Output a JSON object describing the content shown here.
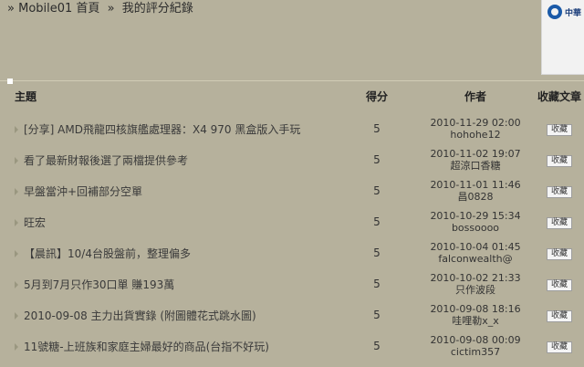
{
  "breadcrumb": {
    "lead": "»",
    "home": "Mobile01 首頁",
    "sep": "»",
    "current": "我的評分紀錄"
  },
  "ad": {
    "logo_text": "中華"
  },
  "table": {
    "headers": {
      "subject": "主題",
      "score": "得分",
      "author": "作者",
      "favorite": "收藏文章"
    },
    "rows": [
      {
        "subject": "[分享] AMD飛龍四核旗艦處理器：X4 970 黑盒版入手玩",
        "score": "5",
        "date": "2010-11-29 02:00",
        "author": "hohohe12",
        "fav": "收藏"
      },
      {
        "subject": "看了最新財報後選了兩檔提供參考",
        "score": "5",
        "date": "2010-11-02 19:07",
        "author": "超涼口香糖",
        "fav": "收藏"
      },
      {
        "subject": "早盤當沖+回補部分空單",
        "score": "5",
        "date": "2010-11-01 11:46",
        "author": "昌0828",
        "fav": "收藏"
      },
      {
        "subject": "旺宏",
        "score": "5",
        "date": "2010-10-29 15:34",
        "author": "bossoooo",
        "fav": "收藏"
      },
      {
        "subject": "【晨訊】10/4台股盤前，整理偏多",
        "score": "5",
        "date": "2010-10-04 01:45",
        "author": "falconwealth@",
        "fav": "收藏"
      },
      {
        "subject": "5月到7月只作30口單 賺193萬",
        "score": "5",
        "date": "2010-10-02 21:33",
        "author": "只作波段",
        "fav": "收藏"
      },
      {
        "subject": "2010-09-08 主力出貨實錄 (附圖體花式跳水圖)",
        "score": "5",
        "date": "2010-09-08 18:16",
        "author": "哇哩勒x_x",
        "fav": "收藏"
      },
      {
        "subject": "11號糖-上班族和家庭主婦最好的商品(台指不好玩)",
        "score": "5",
        "date": "2010-09-08 00:09",
        "author": "cictim357",
        "fav": "收藏"
      }
    ]
  }
}
